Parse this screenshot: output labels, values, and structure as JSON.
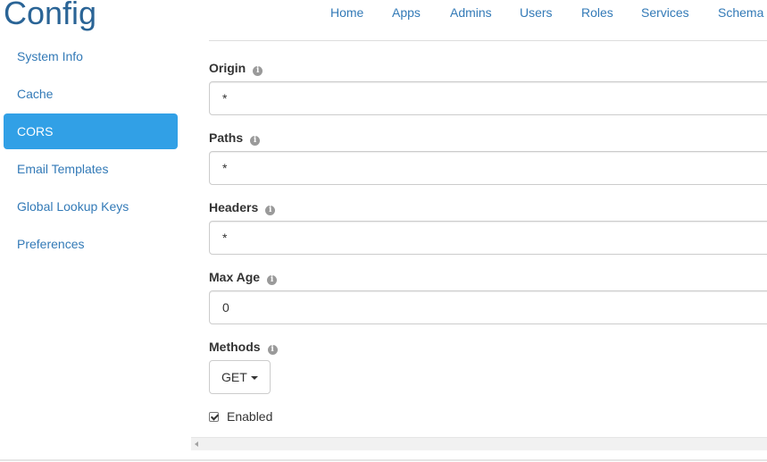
{
  "page": {
    "title": "Config"
  },
  "nav": {
    "home": "Home",
    "apps": "Apps",
    "admins": "Admins",
    "users": "Users",
    "roles": "Roles",
    "services": "Services",
    "schema": "Schema"
  },
  "sidebar": {
    "active_item": "CORS",
    "items": [
      {
        "label": "System Info"
      },
      {
        "label": "Cache"
      },
      {
        "label": "CORS"
      },
      {
        "label": "Email Templates"
      },
      {
        "label": "Global Lookup Keys"
      },
      {
        "label": "Preferences"
      }
    ]
  },
  "form": {
    "origin": {
      "label": "Origin",
      "value": "*"
    },
    "paths": {
      "label": "Paths",
      "value": "*"
    },
    "headers": {
      "label": "Headers",
      "value": "*"
    },
    "max_age": {
      "label": "Max Age",
      "value": "0"
    },
    "methods": {
      "label": "Methods",
      "selected": "GET"
    },
    "enabled": {
      "label": "Enabled",
      "checked": true
    }
  },
  "icons": {
    "info": "info-circle-icon",
    "caret": "caret-down-icon",
    "check": "checkbox-checked-icon"
  },
  "colors": {
    "link": "#337ab7",
    "title": "#2a6496",
    "active_bg": "#31a0e6",
    "active_text": "#ffffff"
  }
}
